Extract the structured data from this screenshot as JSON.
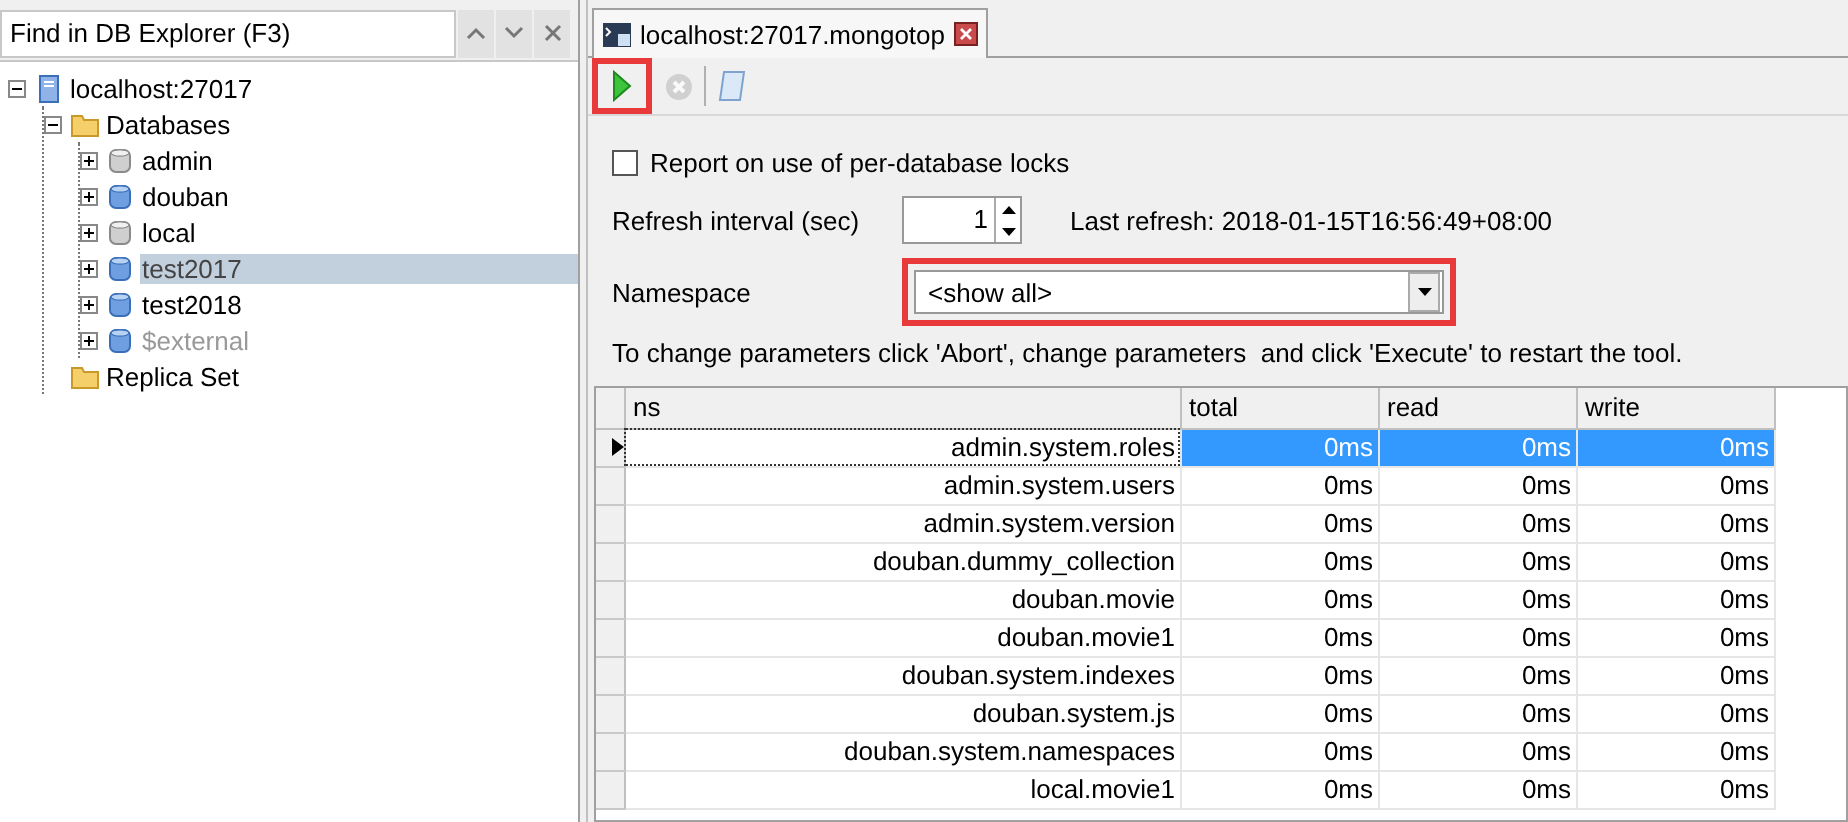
{
  "explorer": {
    "search": {
      "placeholder": "Find in DB Explorer (F3)"
    },
    "tree": [
      {
        "label": "localhost:27017",
        "kind": "server",
        "expanded": true,
        "selected": false,
        "disabled": false,
        "children": [
          {
            "label": "Databases",
            "kind": "folder",
            "expanded": true,
            "selected": false,
            "disabled": false,
            "children": [
              {
                "label": "admin",
                "kind": "inactive-database",
                "expanded": false,
                "selected": false,
                "disabled": false
              },
              {
                "label": "douban",
                "kind": "database",
                "expanded": false,
                "selected": false,
                "disabled": false
              },
              {
                "label": "local",
                "kind": "inactive-database",
                "expanded": false,
                "selected": false,
                "disabled": false
              },
              {
                "label": "test2017",
                "kind": "database",
                "expanded": false,
                "selected": true,
                "disabled": false
              },
              {
                "label": "test2018",
                "kind": "database",
                "expanded": false,
                "selected": false,
                "disabled": false
              },
              {
                "label": "$external",
                "kind": "database",
                "expanded": false,
                "selected": false,
                "disabled": true
              }
            ]
          },
          {
            "label": "Replica Set",
            "kind": "folder",
            "selected": false,
            "disabled": false
          }
        ]
      }
    ]
  },
  "tabs": [
    {
      "label": "localhost:27017.mongotop",
      "selected": true
    }
  ],
  "toolbar": [
    {
      "kind": "run",
      "disabled": false,
      "highlighted": true
    },
    {
      "kind": "abort",
      "disabled": true,
      "highlighted": false
    },
    {
      "kind": "separator"
    },
    {
      "kind": "script",
      "disabled": false,
      "highlighted": false
    }
  ],
  "form": {
    "lock_report": {
      "label": "Report on use of per-database locks",
      "checked": false
    },
    "refresh": {
      "label": "Refresh interval (sec)",
      "value": "1",
      "last_refresh": "Last refresh: 2018-01-15T16:56:49+08:00"
    },
    "namespace": {
      "label": "Namespace",
      "value": "<show all>",
      "highlighted": true
    },
    "hint": "To change parameters click 'Abort', change parameters  and click 'Execute' to restart the tool."
  },
  "table": {
    "columns": [
      "ns",
      "total",
      "read",
      "write"
    ],
    "rows": [
      {
        "cells": [
          "admin.system.roles",
          "0ms",
          "0ms",
          "0ms"
        ],
        "selected": true
      },
      {
        "cells": [
          "admin.system.users",
          "0ms",
          "0ms",
          "0ms"
        ],
        "selected": false
      },
      {
        "cells": [
          "admin.system.version",
          "0ms",
          "0ms",
          "0ms"
        ],
        "selected": false
      },
      {
        "cells": [
          "douban.dummy_collection",
          "0ms",
          "0ms",
          "0ms"
        ],
        "selected": false
      },
      {
        "cells": [
          "douban.movie",
          "0ms",
          "0ms",
          "0ms"
        ],
        "selected": false
      },
      {
        "cells": [
          "douban.movie1",
          "0ms",
          "0ms",
          "0ms"
        ],
        "selected": false
      },
      {
        "cells": [
          "douban.system.indexes",
          "0ms",
          "0ms",
          "0ms"
        ],
        "selected": false
      },
      {
        "cells": [
          "douban.system.js",
          "0ms",
          "0ms",
          "0ms"
        ],
        "selected": false
      },
      {
        "cells": [
          "douban.system.namespaces",
          "0ms",
          "0ms",
          "0ms"
        ],
        "selected": false
      },
      {
        "cells": [
          "local.movie1",
          "0ms",
          "0ms",
          "0ms"
        ],
        "selected": false
      }
    ]
  }
}
